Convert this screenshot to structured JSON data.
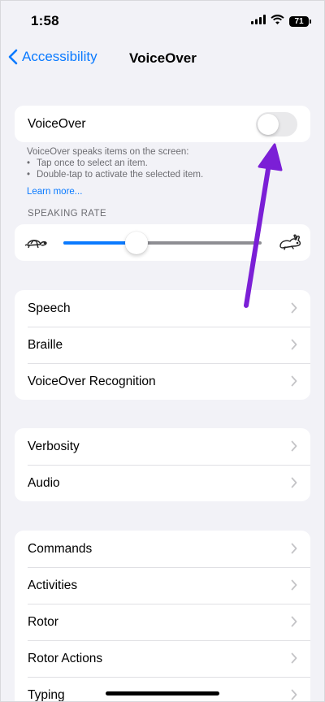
{
  "status_bar": {
    "time": "1:58",
    "battery": "71"
  },
  "nav": {
    "back_label": "Accessibility",
    "title": "VoiceOver"
  },
  "voiceover": {
    "toggle_label": "VoiceOver",
    "toggle_state": "off",
    "description_title": "VoiceOver speaks items on the screen:",
    "bullets": [
      "Tap once to select an item.",
      "Double-tap to activate the selected item."
    ],
    "learn_more": "Learn more..."
  },
  "speaking_rate": {
    "header": "SPEAKING RATE",
    "value_fraction": 0.37
  },
  "group_1": {
    "items": [
      "Speech",
      "Braille",
      "VoiceOver Recognition"
    ]
  },
  "group_2": {
    "items": [
      "Verbosity",
      "Audio"
    ]
  },
  "group_3": {
    "items": [
      "Commands",
      "Activities",
      "Rotor",
      "Rotor Actions",
      "Typing"
    ]
  },
  "colors": {
    "accent": "#0a7aff",
    "background": "#f2f2f7",
    "annotation_arrow": "#7b1fd6"
  }
}
